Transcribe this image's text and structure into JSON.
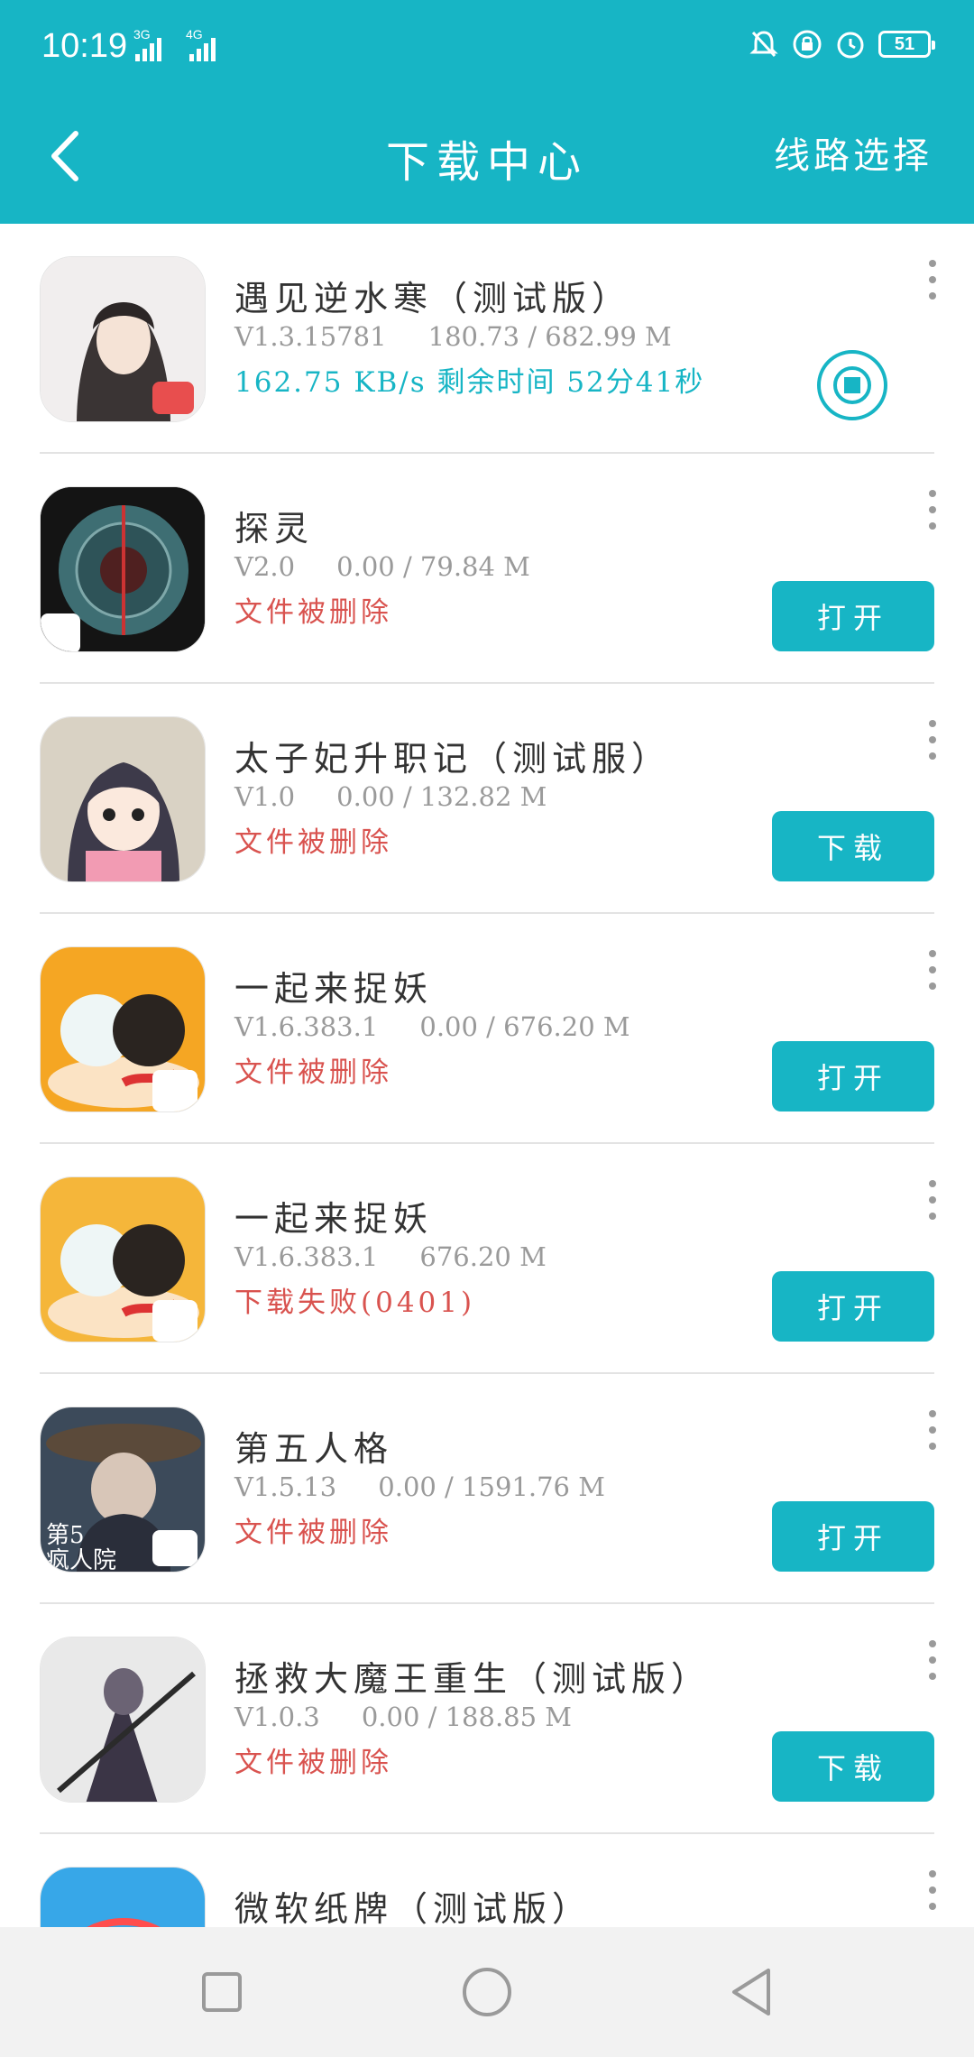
{
  "status_bar": {
    "time": "10:19",
    "net1": "3G",
    "net2": "4G",
    "battery": "51",
    "icons": [
      "bell-off-icon",
      "lock-icon",
      "alarm-icon"
    ]
  },
  "app_bar": {
    "title": "下载中心",
    "route_label": "线路选择"
  },
  "colors": {
    "accent": "#17b5c5",
    "error": "#d9534f",
    "meta": "#9a9a9a"
  },
  "downloads": [
    {
      "name": "遇见逆水寒（测试版）",
      "meta": "V1.3.15781     180.73 / 682.99 M",
      "status": "162.75 KB/s  剩余时间 52分41秒",
      "status_kind": "progress",
      "action": "stop"
    },
    {
      "name": "探灵",
      "meta": "V2.0     0.00 / 79.84 M",
      "status": "文件被删除",
      "status_kind": "error",
      "action_label": "打开"
    },
    {
      "name": "太子妃升职记（测试服）",
      "meta": "V1.0     0.00 / 132.82 M",
      "status": "文件被删除",
      "status_kind": "error",
      "action_label": "下载"
    },
    {
      "name": "一起来捉妖",
      "meta": "V1.6.383.1     0.00 / 676.20 M",
      "status": "文件被删除",
      "status_kind": "error",
      "action_label": "打开"
    },
    {
      "name": "一起来捉妖",
      "meta": "V1.6.383.1     676.20 M",
      "status": "下载失败(0401)",
      "status_kind": "error",
      "action_label": "打开"
    },
    {
      "name": "第五人格",
      "meta": "V1.5.13     0.00 / 1591.76 M",
      "status": "文件被删除",
      "status_kind": "error",
      "action_label": "打开",
      "icon_text": "第5\n疯人院"
    },
    {
      "name": "拯救大魔王重生（测试版）",
      "meta": "V1.0.3     0.00 / 188.85 M",
      "status": "文件被删除",
      "status_kind": "error",
      "action_label": "下载"
    },
    {
      "name": "微软纸牌（测试版）",
      "meta": "",
      "status": "",
      "status_kind": "none"
    }
  ],
  "nav_bar": {
    "buttons": [
      "recents-square-icon",
      "home-circle-icon",
      "back-triangle-icon"
    ]
  }
}
